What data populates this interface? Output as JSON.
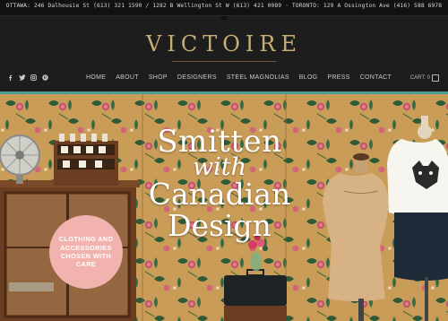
{
  "topbar": {
    "locations": "OTTAWA: 246 Dalhousie St (613) 321 1590 / 1282 B Wellington St W (613) 421 0089 · TORONTO: 129 A Ossington Ave (416) 588 6978"
  },
  "logo": {
    "text": "VICTOIRE"
  },
  "social": {
    "icons": [
      "facebook-icon",
      "twitter-icon",
      "instagram-icon",
      "pinterest-icon"
    ]
  },
  "nav": {
    "items": [
      "HOME",
      "ABOUT",
      "SHOP",
      "DESIGNERS",
      "STEEL MAGNOLIAS",
      "BLOG",
      "PRESS",
      "CONTACT"
    ]
  },
  "cart": {
    "label": "CART: 0"
  },
  "hero": {
    "headline": {
      "line1": "Smitten",
      "line2": "with",
      "line3": "Canadian",
      "line4": "Design"
    },
    "badge": "CLOTHING AND ACCESSORIES CHOSEN WITH CARE"
  },
  "colors": {
    "accent": "#4a9b93",
    "logo": "#c9ad74",
    "badge": "#f2b3ae",
    "wallpaper": "#c99c58"
  }
}
